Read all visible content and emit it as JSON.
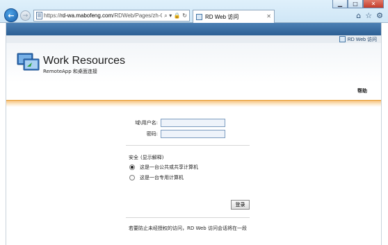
{
  "browser": {
    "address_scheme": "https://",
    "address_host": "rd-wa.mabofeng.com",
    "address_path": "/RDWeb/Pages/zh-CN",
    "address_tools": "⌕ ▾ 🔒 ↻",
    "tab_title": "RD Web 访问"
  },
  "banner": {
    "label": "RD Web 访问"
  },
  "header": {
    "title": "Work Resources",
    "subtitle": "RemoteApp 和桌面连接",
    "help": "帮助"
  },
  "login": {
    "domain_user_label": "域\\用户名:",
    "password_label": "密码:",
    "domain_user_value": "",
    "password_value": ""
  },
  "security": {
    "label": "安全",
    "link_text": "(显示解释)",
    "options": [
      {
        "label": "这是一台公共或共享计算机",
        "checked": true
      },
      {
        "label": "这是一台专用计算机",
        "checked": false
      }
    ]
  },
  "signin_button": "登录",
  "footer_note": "若要防止未经授权的访问，RD Web 访问会话将在一段"
}
